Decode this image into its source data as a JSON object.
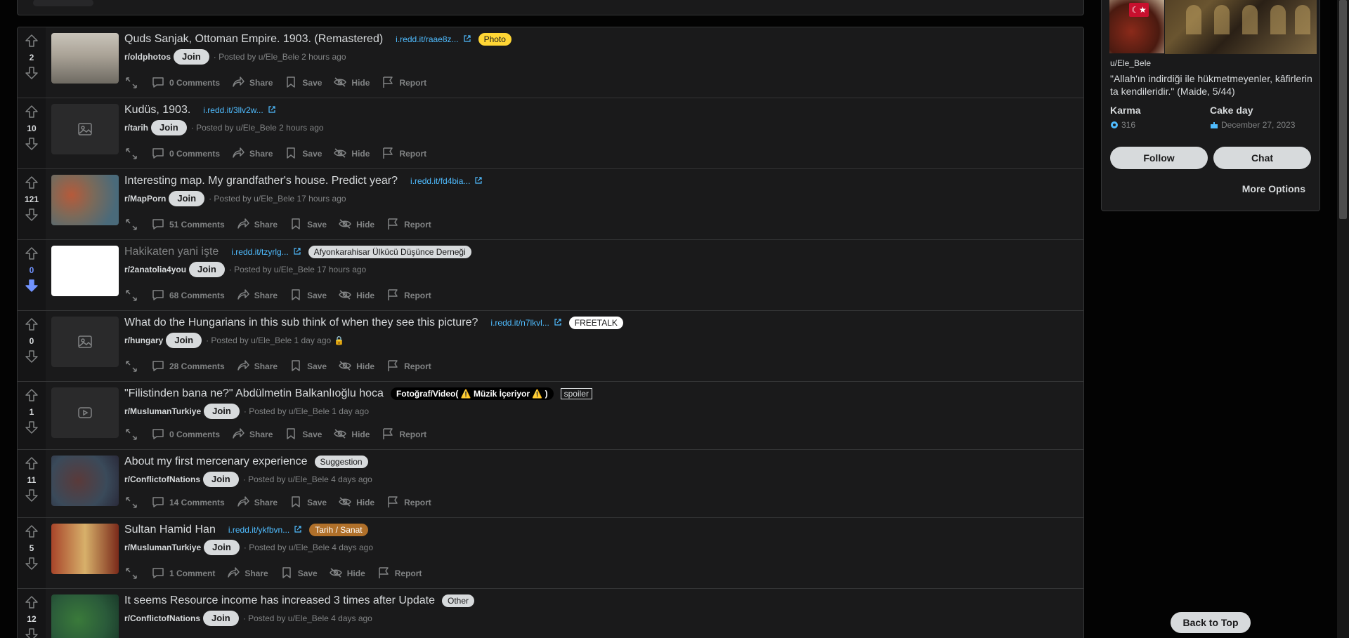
{
  "colors": {
    "page_bg": "#030303",
    "card_bg": "#1a1a1b",
    "border": "#343536",
    "text": "#d7dadc",
    "muted": "#818384",
    "link": "#4fbcff",
    "downvote_active": "#7193ff"
  },
  "posts": [
    {
      "score": "2",
      "title": "Quds Sanjak, Ottoman Empire. 1903. (Remastered)",
      "link": "i.redd.it/raae8z...",
      "flair": "Photo",
      "subreddit": "r/oldphotos",
      "join": "Join",
      "posted": "· Posted by u/Ele_Bele 2 hours ago",
      "comments": "0 Comments",
      "thumb": "photo",
      "visited": false
    },
    {
      "score": "10",
      "title": "Kudüs, 1903.",
      "link": "i.redd.it/3llv2w...",
      "flair": "",
      "subreddit": "r/tarih",
      "join": "Join",
      "posted": "· Posted by u/Ele_Bele 2 hours ago",
      "comments": "0 Comments",
      "thumb": "image-placeholder",
      "visited": false
    },
    {
      "score": "121",
      "title": "Interesting map. My grandfather's house. Predict year?",
      "link": "i.redd.it/fd4bia...",
      "flair": "",
      "subreddit": "r/MapPorn",
      "join": "Join",
      "posted": "· Posted by u/Ele_Bele 17 hours ago",
      "comments": "51 Comments",
      "thumb": "map",
      "visited": false
    },
    {
      "score": "0",
      "title": "Hakikaten yani işte",
      "link": "i.redd.it/tzyrlg...",
      "flair": "Afyonkarahisar Ülkücü Düşünce Derneği",
      "subreddit": "r/2anatolia4you",
      "join": "Join",
      "posted": "· Posted by u/Ele_Bele 17 hours ago",
      "comments": "68 Comments",
      "thumb": "document",
      "visited": true,
      "downvoted": true
    },
    {
      "score": "0",
      "title": "What do the Hungarians in this sub think of when they see this picture?",
      "link": "i.redd.it/n7lkvl...",
      "flair": "FREETALK",
      "subreddit": "r/hungary",
      "join": "Join",
      "posted": "· Posted by u/Ele_Bele 1 day ago",
      "comments": "28 Comments",
      "thumb": "image-placeholder",
      "visited": false,
      "locked": true
    },
    {
      "score": "1",
      "title": "\"Filistinden bana ne?\" Abdülmetin Balkanlıoğlu hoca",
      "link": "",
      "flair": "Fotoğraf/Video( ⚠️ Müzik İçeriyor ⚠️ )",
      "spoiler": "spoiler",
      "subreddit": "r/MuslumanTurkiye",
      "join": "Join",
      "posted": "· Posted by u/Ele_Bele 1 day ago",
      "comments": "0 Comments",
      "thumb": "video-placeholder",
      "visited": false
    },
    {
      "score": "11",
      "title": "About my first mercenary experience",
      "link": "",
      "flair": "Suggestion",
      "subreddit": "r/ConflictofNations",
      "join": "Join",
      "posted": "· Posted by u/Ele_Bele 4 days ago",
      "comments": "14 Comments",
      "thumb": "game-map",
      "visited": false
    },
    {
      "score": "5",
      "title": "Sultan Hamid Han",
      "link": "i.redd.it/ykfbvn...",
      "flair": "Tarih / Sanat",
      "subreddit": "r/MuslumanTurkiye",
      "join": "Join",
      "posted": "· Posted by u/Ele_Bele 4 days ago",
      "comments": "1 Comment",
      "thumb": "portrait",
      "visited": false
    },
    {
      "score": "12",
      "title": "It seems Resource income has increased 3 times after Update",
      "link": "",
      "flair": "Other",
      "subreddit": "r/ConflictofNations",
      "join": "Join",
      "posted": "· Posted by u/Ele_Bele 4 days ago",
      "comments": "",
      "thumb": "game-map-green",
      "visited": false
    }
  ],
  "actions": {
    "share": "Share",
    "save": "Save",
    "hide": "Hide",
    "report": "Report"
  },
  "profile": {
    "username": "u/Ele_Bele",
    "bio": "\"Allah'ın indirdiği ile hükmetmeyenler, kâfirlerin ta kendileridir.\" (Maide, 5/44)",
    "karma_label": "Karma",
    "karma_value": "316",
    "cakeday_label": "Cake day",
    "cakeday_value": "December 27, 2023",
    "follow": "Follow",
    "chat": "Chat",
    "more_options": "More Options"
  },
  "back_to_top": "Back to Top"
}
